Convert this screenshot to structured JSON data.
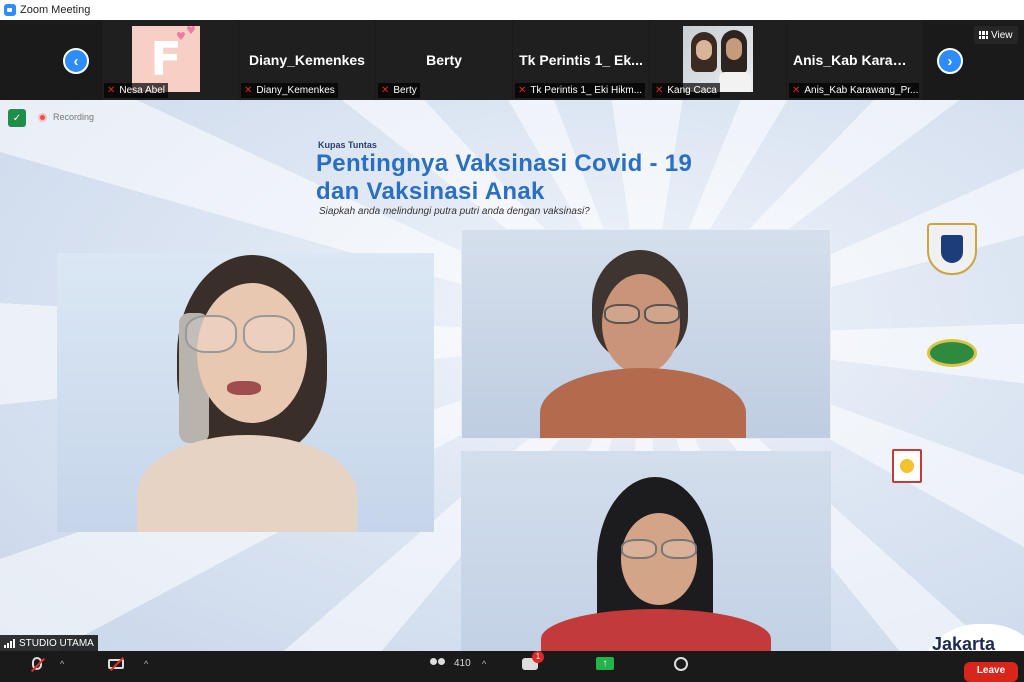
{
  "window": {
    "title": "Zoom Meeting"
  },
  "participants_strip": {
    "tiles": [
      {
        "label": "Nesa Abel",
        "avatar_letter": "F"
      },
      {
        "label": "Diany_Kemenkes",
        "big_name": "Diany_Kemenkes"
      },
      {
        "label": "Berty",
        "big_name": "Berty"
      },
      {
        "label": "Tk Perintis 1_ Eki Hikm...",
        "big_name": "Tk Perintis 1_ Ek..."
      },
      {
        "label": "Kang Caca"
      },
      {
        "label": "Anis_Kab Karawang_Pr...",
        "big_name": "Anis_Kab Karawa..."
      }
    ],
    "view_label": "View"
  },
  "status": {
    "recording_label": "Recording"
  },
  "slide": {
    "kicker": "Kupas Tuntas",
    "title_line1": "Pentingnya Vaksinasi Covid - 19",
    "title_line2": "dan Vaksinasi Anak",
    "subtitle": "Siapkah anda melindungi putra putri anda dengan vaksinasi?",
    "brand": "Jakarta"
  },
  "active_speaker": {
    "name": "STUDIO UTAMA"
  },
  "toolbar": {
    "participants_count": "410",
    "chat_badge": "1",
    "leave_label": "Leave"
  },
  "colors": {
    "accent": "#2d8cff",
    "leave": "#d9261c",
    "muted": "#e02828",
    "share": "#23b34a"
  }
}
